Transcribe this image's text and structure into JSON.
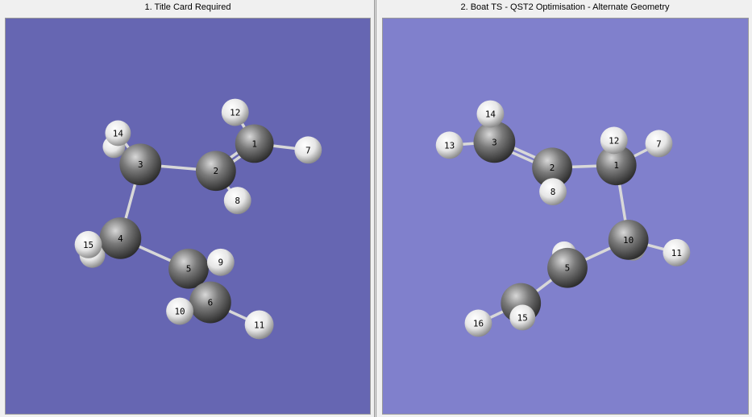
{
  "panes": [
    {
      "title": "1.  Title Card Required",
      "background": "#6666b2",
      "atom_labels": [
        "1",
        "2",
        "3",
        "4",
        "5",
        "6",
        "7",
        "8",
        "9",
        "10",
        "11",
        "12",
        "14",
        "15"
      ]
    },
    {
      "title": "2.  Boat TS - QST2 Optimisation - Alternate Geometry",
      "background": "#8080cc",
      "atom_labels": [
        "1",
        "2",
        "3",
        "5",
        "7",
        "8",
        "10",
        "11",
        "12",
        "13",
        "14",
        "15",
        "16"
      ]
    }
  ],
  "colors": {
    "carbon": "#7a7a7a",
    "hydrogen": "#e6e6e6",
    "bond": "#d8d8d8",
    "label": "#000000"
  }
}
